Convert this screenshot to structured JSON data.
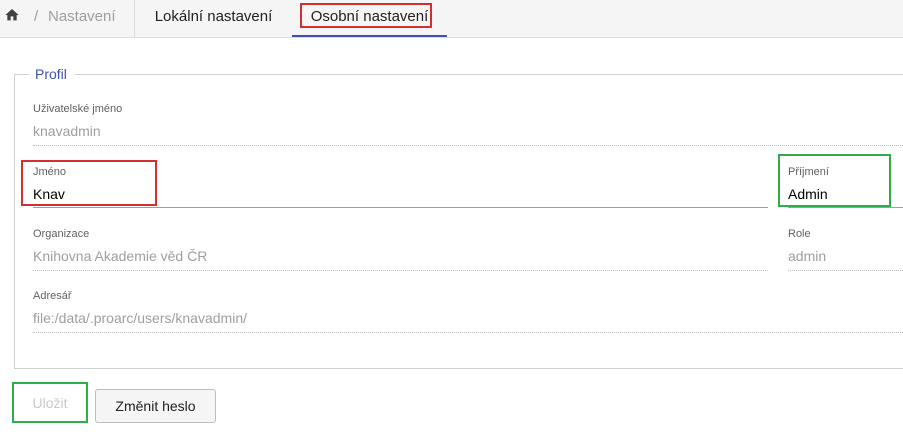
{
  "breadcrumb": {
    "home_icon": "home-icon",
    "separator": "/",
    "section": "Nastavení"
  },
  "tabs": [
    {
      "label": "Lokální nastavení",
      "active": false
    },
    {
      "label": "Osobní nastavení",
      "active": true
    }
  ],
  "profile": {
    "legend": "Profil",
    "username_label": "Uživatelské jméno",
    "username_value": "knavadmin",
    "first_name_label": "Jméno",
    "first_name_value": "Knav",
    "last_name_label": "Příjmení",
    "last_name_value": "Admin",
    "organization_label": "Organizace",
    "organization_value": "Knihovna Akademie věd ČR",
    "role_label": "Role",
    "role_value": "admin",
    "directory_label": "Adresář",
    "directory_value": "file:/data/.proarc/users/knavadmin/"
  },
  "actions": {
    "save_label": "Uložit",
    "change_password_label": "Změnit heslo"
  },
  "colors": {
    "accent": "#3f51b5",
    "highlight_red": "#d32f2f",
    "highlight_green": "#2eae4a"
  }
}
